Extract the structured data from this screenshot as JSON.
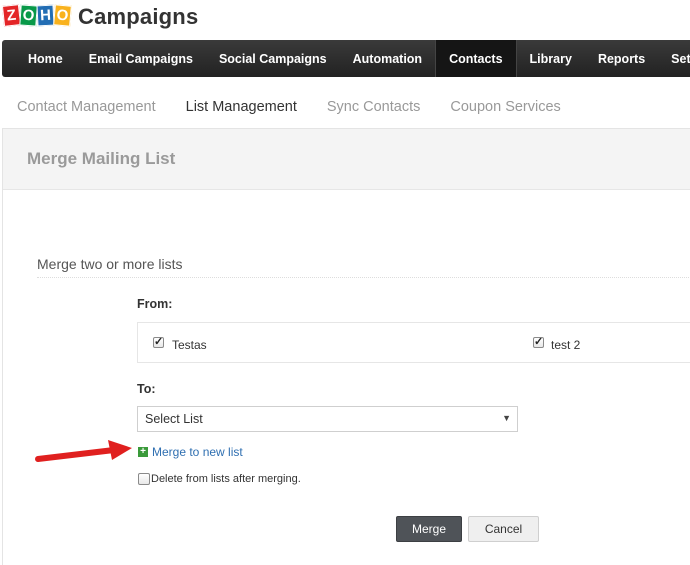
{
  "logo": {
    "tiles": [
      "Z",
      "O",
      "H",
      "O"
    ],
    "product": "Campaigns"
  },
  "nav": {
    "items": [
      "Home",
      "Email Campaigns",
      "Social Campaigns",
      "Automation",
      "Contacts",
      "Library",
      "Reports",
      "Settings"
    ],
    "active": "Contacts"
  },
  "subnav": {
    "items": [
      "Contact Management",
      "List Management",
      "Sync Contacts",
      "Coupon Services"
    ],
    "active": "List Management"
  },
  "panel": {
    "title": "Merge Mailing List"
  },
  "form": {
    "section_title": "Merge two or more lists",
    "from_label": "From:",
    "lists": [
      {
        "name": "Testas",
        "checked": true
      },
      {
        "name": "test 2",
        "checked": true
      }
    ],
    "to_label": "To:",
    "select_value": "Select List",
    "merge_new_link": "Merge to new list",
    "delete_label": "Delete from lists after merging.",
    "delete_checked": false,
    "merge_button": "Merge",
    "cancel_button": "Cancel"
  },
  "colors": {
    "accent_link": "#2f6fb1",
    "annotation_arrow": "#e0201f",
    "nav_bg": "#2b2b2b"
  },
  "icons": {
    "dropdown": "triangle-down-icon",
    "add": "plus-square-icon",
    "annotation": "red-arrow-icon"
  }
}
